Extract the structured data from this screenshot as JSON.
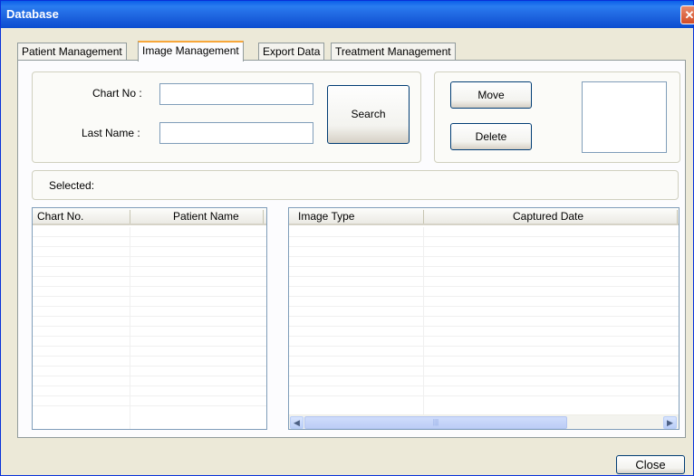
{
  "window": {
    "title": "Database",
    "close_glyph": "✕"
  },
  "tabs": [
    {
      "label": "Patient Management",
      "active": false
    },
    {
      "label": "Image Management",
      "active": true
    },
    {
      "label": "Export Data",
      "active": false
    },
    {
      "label": "Treatment Management",
      "active": false
    }
  ],
  "search": {
    "chart_no_label": "Chart No :",
    "chart_no_value": "",
    "last_name_label": "Last Name :",
    "last_name_value": "",
    "search_button": "Search"
  },
  "actions": {
    "move_button": "Move",
    "delete_button": "Delete"
  },
  "selected_label": "Selected:",
  "patient_list": {
    "columns": [
      "Chart No.",
      "Patient Name"
    ],
    "rows": []
  },
  "image_list": {
    "columns": [
      "Image Type",
      "Captured Date"
    ],
    "rows": []
  },
  "footer": {
    "close_button": "Close"
  },
  "icons": {
    "scroll_left": "◀",
    "scroll_right": "▶",
    "thumb_grip": "|||"
  },
  "colors": {
    "title_bar": "#0a5ee8",
    "tab_highlight": "#f7a73b",
    "window_bg": "#ece9d8"
  }
}
